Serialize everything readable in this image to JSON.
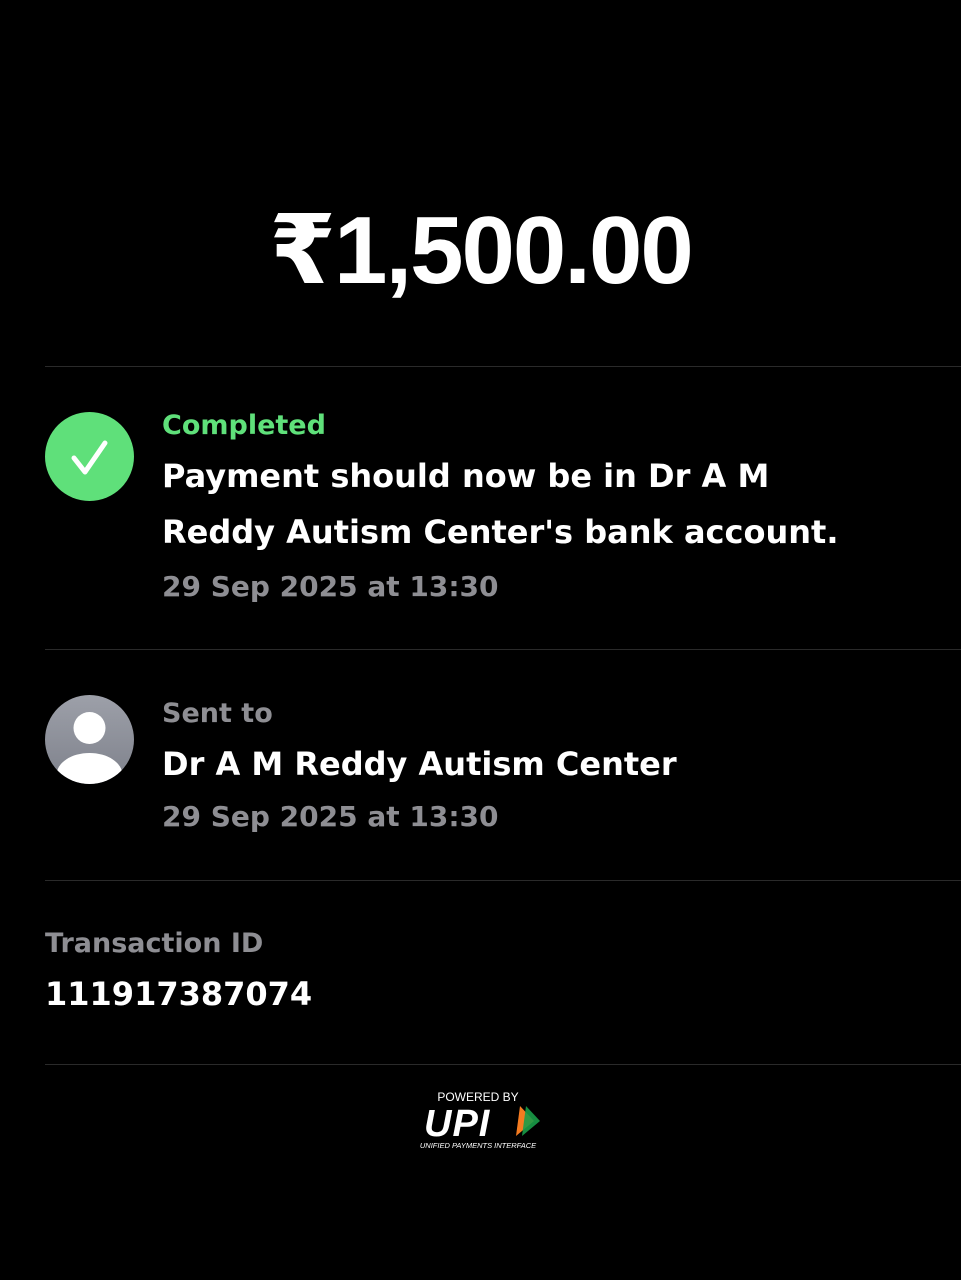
{
  "payment": {
    "amount": "₹1,500.00"
  },
  "status": {
    "label": "Completed",
    "message": "Payment should now be in Dr A M Reddy Autism Center's bank account.",
    "timestamp": "29 Sep 2025 at 13:30",
    "icon": "checkmark-icon",
    "color": "#5fe07a"
  },
  "recipient": {
    "label": "Sent to",
    "name": "Dr A M Reddy Autism Center",
    "timestamp": "29 Sep 2025 at 13:30",
    "icon": "avatar-icon"
  },
  "transaction": {
    "label": "Transaction ID",
    "id": "111917387074"
  },
  "footer": {
    "powered_by": "POWERED BY",
    "brand": "UPI",
    "brand_subtitle": "UNIFIED PAYMENTS INTERFACE",
    "brand_colors": [
      "#ffffff",
      "#f47b20",
      "#1a9c48"
    ]
  }
}
